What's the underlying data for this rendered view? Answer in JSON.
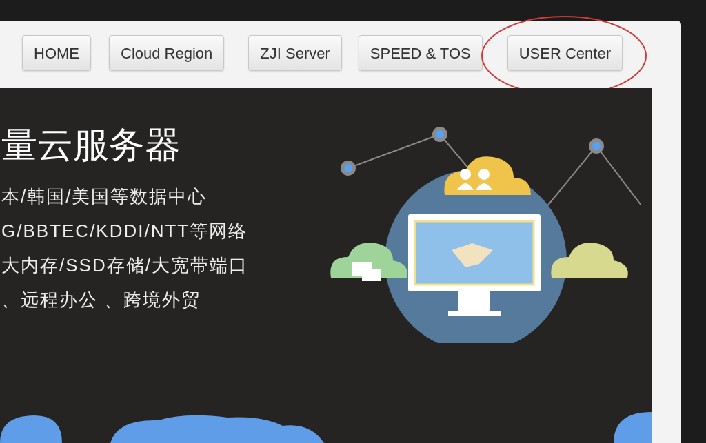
{
  "nav": {
    "items": [
      {
        "label": "HOME"
      },
      {
        "label": "Cloud Region"
      },
      {
        "label": "ZJI Server"
      },
      {
        "label": "SPEED & TOS"
      },
      {
        "label": "USER Center",
        "circled": true
      }
    ]
  },
  "banner": {
    "title": "量云服务器",
    "lines": [
      "本/韩国/美国等数据中心",
      "G/BBTEC/KDDI/NTT等网络",
      "大内存/SSD存储/大宽带端口",
      "、远程办公 、跨境外贸"
    ]
  }
}
